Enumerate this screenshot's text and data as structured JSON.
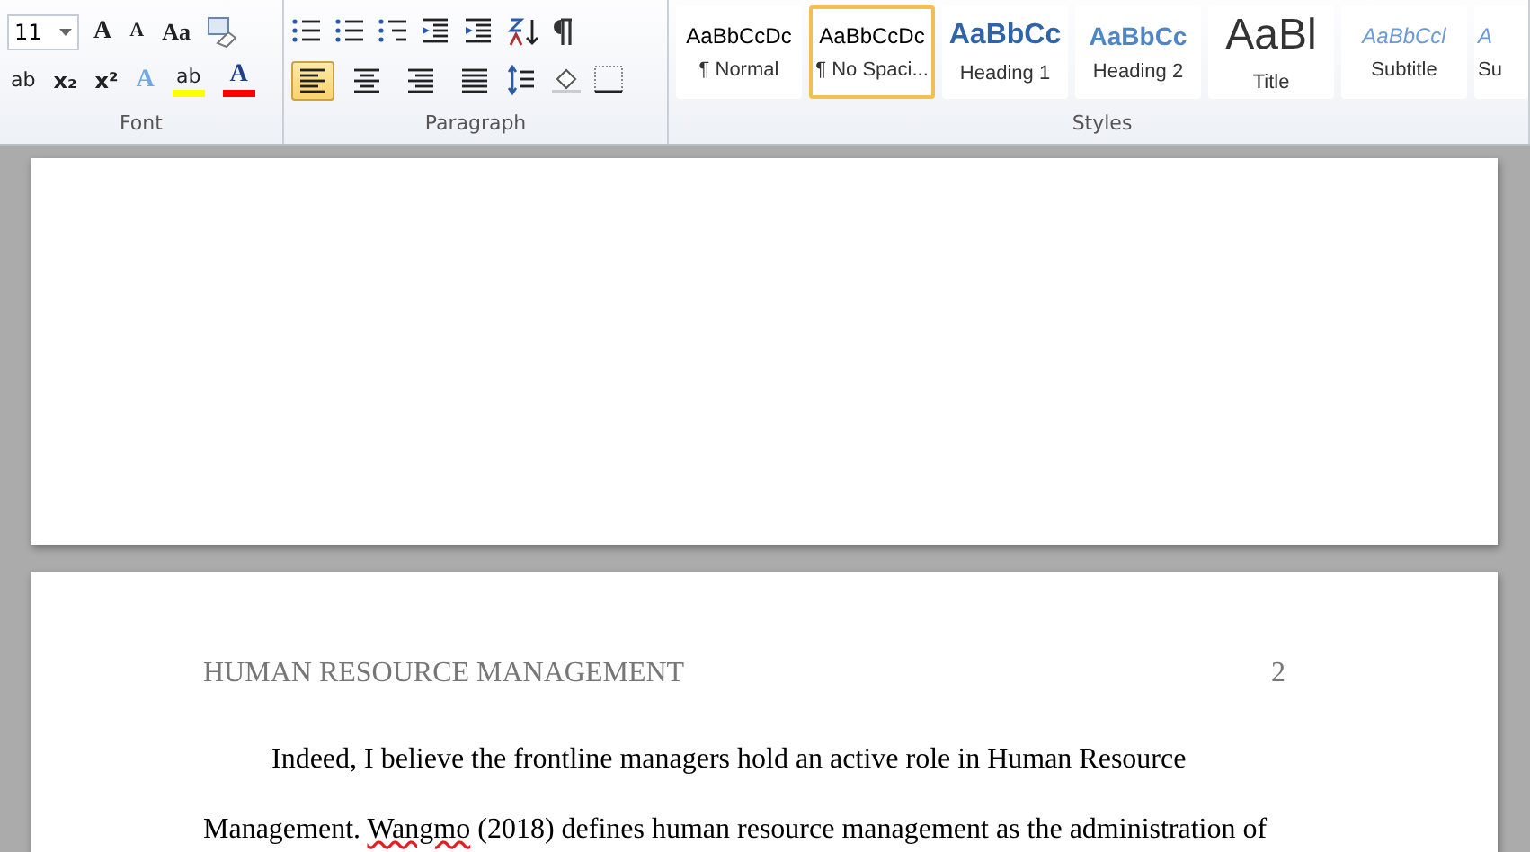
{
  "ribbon": {
    "font_group": {
      "label": "Font",
      "font_size": "11",
      "row1": [
        {
          "kind": "text",
          "label": "A"
        },
        {
          "kind": "text",
          "label": "A"
        },
        {
          "kind": "text",
          "label": "Aa"
        },
        {
          "kind": "icon"
        }
      ],
      "row2": [
        {
          "label": "ab"
        },
        {
          "label": "x₂"
        },
        {
          "label": "x²"
        },
        {
          "label": "A"
        },
        {
          "label": "ab",
          "color": "#ffff00"
        },
        {
          "label": "A",
          "color": "#ff0000"
        }
      ]
    },
    "paragraph_group": {
      "label": "Paragraph",
      "row2": [
        {
          "selected": true
        },
        {
          "selected": false
        },
        {
          "selected": false
        },
        {
          "selected": false
        }
      ]
    },
    "styles_group": {
      "label": "Styles",
      "items": [
        {
          "preview": "AaBbCcDc",
          "name": "¶ Normal",
          "kind": "normal",
          "selected": false
        },
        {
          "preview": "AaBbCcDc",
          "name": "¶ No Spaci...",
          "kind": "normal",
          "selected": true
        },
        {
          "preview": "AaBbCc",
          "name": "Heading 1",
          "kind": "heading1",
          "selected": false
        },
        {
          "preview": "AaBbCc",
          "name": "Heading 2",
          "kind": "heading2",
          "selected": false
        },
        {
          "preview": "AaBl",
          "name": "Title",
          "kind": "title",
          "selected": false
        },
        {
          "preview": "AaBbCcl",
          "name": "Subtitle",
          "kind": "subtitle",
          "selected": false
        },
        {
          "preview": "A",
          "name": "Su",
          "kind": "subtitle",
          "selected": false
        }
      ]
    }
  },
  "page2": {
    "header": "HUMAN RESOURCE MANAGEMENT",
    "page_number": "2",
    "lines": [
      [
        {
          "text": "Indeed, I believe the frontline managers hold an active role in Human Resource",
          "misspelled": false
        }
      ],
      [
        {
          "text": "Management. ",
          "misspelled": false
        },
        {
          "text": "Wangmo",
          "misspelled": true
        },
        {
          "text": " (2018) defines human resource management as the administration of",
          "misspelled": false
        }
      ]
    ]
  }
}
